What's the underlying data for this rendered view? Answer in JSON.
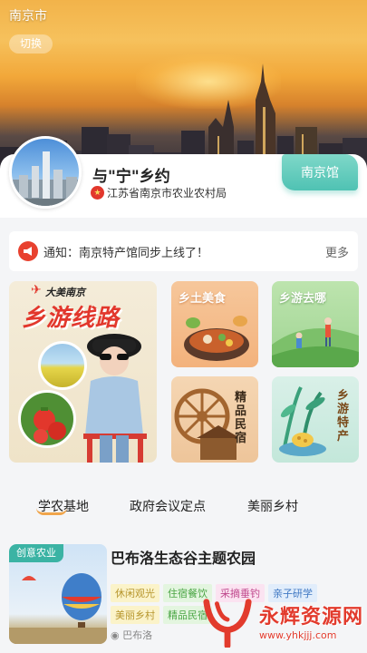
{
  "header": {
    "city": "南京市",
    "switch_label": "切换"
  },
  "profile": {
    "name": "与\"宁\"乡约",
    "organization": "江苏省南京市农业农村局",
    "pavilion_button": "南京馆"
  },
  "notice": {
    "label": "通知：南京特产馆同步上线了！",
    "more": "更多"
  },
  "tiles": {
    "big": {
      "brand": "大美南京",
      "title": "乡游线路"
    },
    "t1": {
      "label": "乡土美食"
    },
    "t2": {
      "label": "乡游去哪"
    },
    "t3": {
      "label": "精品民宿"
    },
    "t4": {
      "label": "乡游特产"
    }
  },
  "tabs": [
    {
      "label": "学农基地",
      "active": true
    },
    {
      "label": "政府会议定点",
      "active": false
    },
    {
      "label": "美丽乡村",
      "active": false
    }
  ],
  "feature": {
    "badge": "创意农业",
    "title": "巴布洛生态谷主题农园",
    "tags": [
      "休闲观光",
      "住宿餐饮",
      "采摘垂钓",
      "亲子研学",
      "美丽乡村",
      "精品民宿"
    ],
    "location": "巴布洛"
  },
  "watermark": {
    "cn": "永辉资源网",
    "url": "www.yhkjjj.com"
  },
  "colors": {
    "accent": "#4fc2b3",
    "red": "#e2372c",
    "tab_underline": "#f0a54b"
  }
}
